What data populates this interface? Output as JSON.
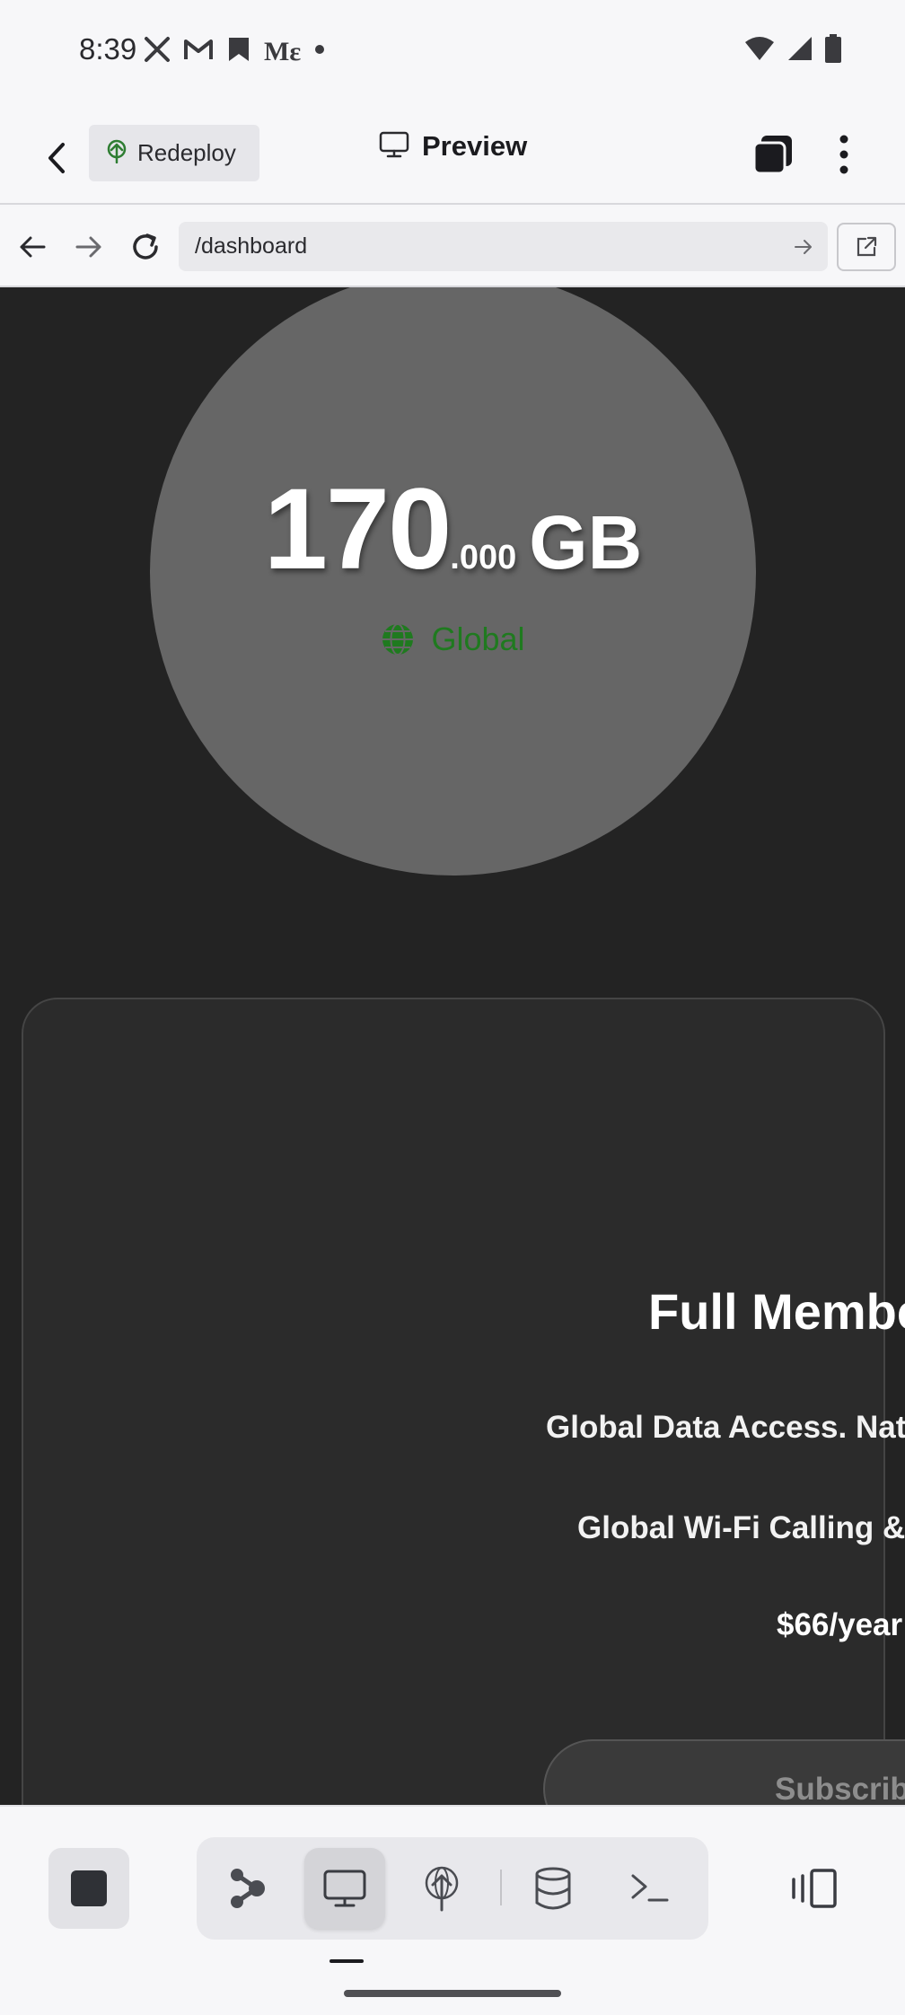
{
  "status_bar": {
    "time": "8:39",
    "left_icons": [
      "x-icon",
      "gmail-icon",
      "bookmark-icon",
      "medium-icon",
      "dot-icon"
    ],
    "medium_text": "Mε",
    "right_icons": [
      "wifi-icon",
      "signal-icon",
      "battery-icon"
    ]
  },
  "header": {
    "redeploy_label": "Redeploy",
    "preview_label": "Preview"
  },
  "url_bar": {
    "url": "/dashboard"
  },
  "usage": {
    "amount_int": "170",
    "amount_dec": ".000",
    "unit": "GB",
    "region": "Global"
  },
  "plan": {
    "title": "Full Membe",
    "feature_1": "Global Data Access. Nati",
    "feature_2": "Global Wi-Fi Calling & S",
    "price": "$66/year",
    "subscribe_label": "Subscribe"
  },
  "toolbar": {
    "tools": [
      "share-graph-icon",
      "desktop-preview-icon",
      "deploy-icon",
      "database-icon",
      "terminal-icon"
    ],
    "active_tool": "desktop-preview-icon"
  },
  "colors": {
    "preview_bg": "#232323",
    "circle_bg": "#666666",
    "card_bg": "#2b2b2b",
    "region_green": "#1f7a1f",
    "chrome_bg": "#f7f7f9"
  }
}
